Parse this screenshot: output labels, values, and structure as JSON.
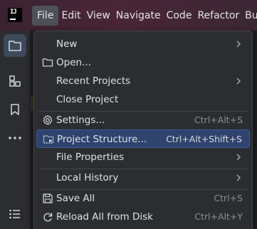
{
  "app": {
    "logo_text": "IJ"
  },
  "menubar": {
    "items": [
      {
        "label": "File"
      },
      {
        "label": "Edit"
      },
      {
        "label": "View"
      },
      {
        "label": "Navigate"
      },
      {
        "label": "Code"
      },
      {
        "label": "Refactor"
      },
      {
        "label": "Bu"
      }
    ]
  },
  "toolstrip": {
    "icons": [
      "folder-icon",
      "structure-icon",
      "bookmark-icon",
      "more-icon",
      "list-icon"
    ]
  },
  "file_menu": {
    "items": [
      {
        "label": "New",
        "shortcut": "",
        "submenu": true,
        "icon": ""
      },
      {
        "label": "Open...",
        "shortcut": "",
        "submenu": false,
        "icon": "folder-icon"
      },
      {
        "label": "Recent Projects",
        "shortcut": "",
        "submenu": true,
        "icon": ""
      },
      {
        "label": "Close Project",
        "shortcut": "",
        "submenu": false,
        "icon": ""
      },
      {
        "label": "Settings...",
        "shortcut": "Ctrl+Alt+S",
        "submenu": false,
        "icon": "gear-icon"
      },
      {
        "label": "Project Structure...",
        "shortcut": "Ctrl+Alt+Shift+S",
        "submenu": false,
        "icon": "project-structure-icon"
      },
      {
        "label": "File Properties",
        "shortcut": "",
        "submenu": true,
        "icon": ""
      },
      {
        "label": "Local History",
        "shortcut": "",
        "submenu": true,
        "icon": ""
      },
      {
        "label": "Save All",
        "shortcut": "Ctrl+S",
        "submenu": false,
        "icon": "save-icon"
      },
      {
        "label": "Reload All from Disk",
        "shortcut": "Ctrl+Alt+Y",
        "submenu": false,
        "icon": "reload-icon"
      }
    ],
    "highlighted": "Project Structure..."
  },
  "colors": {
    "highlight": "#2e436e",
    "titlebar": "#4a2637"
  }
}
